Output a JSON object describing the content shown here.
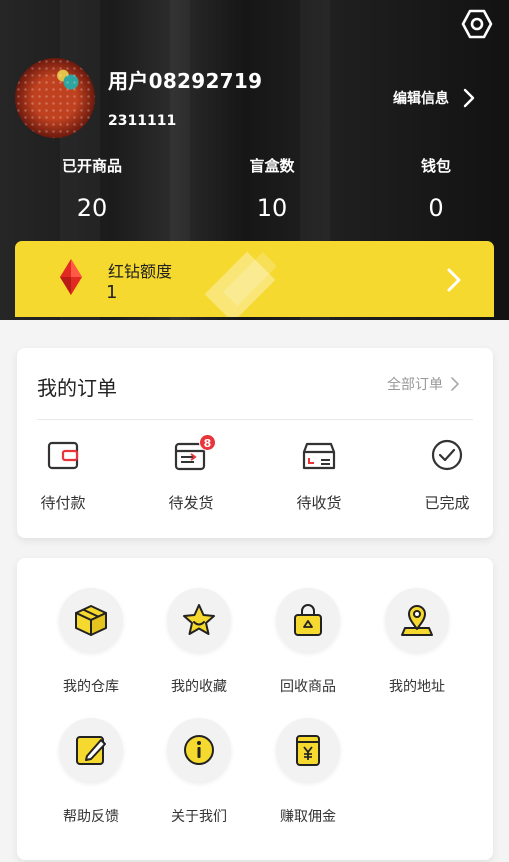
{
  "header": {
    "settings_icon": "settings-hexagon-icon",
    "avatar_icon": "user-avatar",
    "username": "用户08292719",
    "user_id": "2311111",
    "edit_label": "编辑信息",
    "stats": [
      {
        "label": "已开商品",
        "value": "20"
      },
      {
        "label": "盲盒数",
        "value": "10"
      },
      {
        "label": "钱包",
        "value": "0"
      }
    ]
  },
  "diamond": {
    "title": "红钻额度",
    "value": "1",
    "icon": "red-diamond-icon",
    "color": "#f6d92e"
  },
  "orders": {
    "title": "我的订单",
    "all_label": "全部订单",
    "items": [
      {
        "label": "待付款",
        "icon": "wallet-icon"
      },
      {
        "label": "待发货",
        "icon": "shipping-box-icon",
        "badge": "8"
      },
      {
        "label": "待收货",
        "icon": "package-receive-icon"
      },
      {
        "label": "已完成",
        "icon": "check-circle-icon"
      }
    ]
  },
  "services": {
    "items": [
      {
        "label": "我的仓库",
        "icon": "warehouse-box-icon"
      },
      {
        "label": "我的收藏",
        "icon": "star-favorite-icon"
      },
      {
        "label": "回收商品",
        "icon": "recycle-bag-icon"
      },
      {
        "label": "我的地址",
        "icon": "location-pin-icon"
      },
      {
        "label": "帮助反馈",
        "icon": "feedback-edit-icon"
      },
      {
        "label": "关于我们",
        "icon": "info-icon"
      },
      {
        "label": "赚取佣金",
        "icon": "commission-yen-icon"
      }
    ]
  },
  "colors": {
    "accent": "#f6d92e",
    "badge": "#e8343a",
    "icon_yellow": "#f6d92e",
    "header_bg": "#1e1e1e"
  }
}
